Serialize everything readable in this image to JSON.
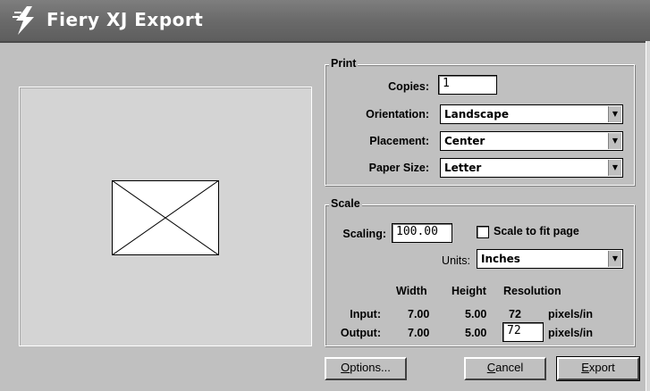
{
  "window": {
    "title": "Fiery XJ Export"
  },
  "print": {
    "group_label": "Print",
    "copies_label": "Copies:",
    "copies_value": "1",
    "orientation_label": "Orientation:",
    "orientation_value": "Landscape",
    "placement_label": "Placement:",
    "placement_value": "Center",
    "paper_size_label": "Paper Size:",
    "paper_size_value": "Letter"
  },
  "scale": {
    "group_label": "Scale",
    "scaling_label": "Scaling:",
    "scaling_value": "100.00",
    "fit_label": "Scale to fit page",
    "fit_checked": false,
    "units_label": "Units:",
    "units_value": "Inches",
    "headers": {
      "width": "Width",
      "height": "Height",
      "resolution": "Resolution"
    },
    "input": {
      "label": "Input:",
      "width": "7.00",
      "height": "5.00",
      "resolution": "72",
      "unit": "pixels/in"
    },
    "output": {
      "label": "Output:",
      "width": "7.00",
      "height": "5.00",
      "resolution": "72",
      "unit": "pixels/in"
    }
  },
  "buttons": {
    "options_first": "O",
    "options_rest": "ptions...",
    "cancel_first": "C",
    "cancel_rest": "ancel",
    "export_first": "E",
    "export_rest": "xport"
  },
  "icons": {
    "app": "lightning-bolt-icon",
    "dropdown": "chevron-down-icon"
  }
}
